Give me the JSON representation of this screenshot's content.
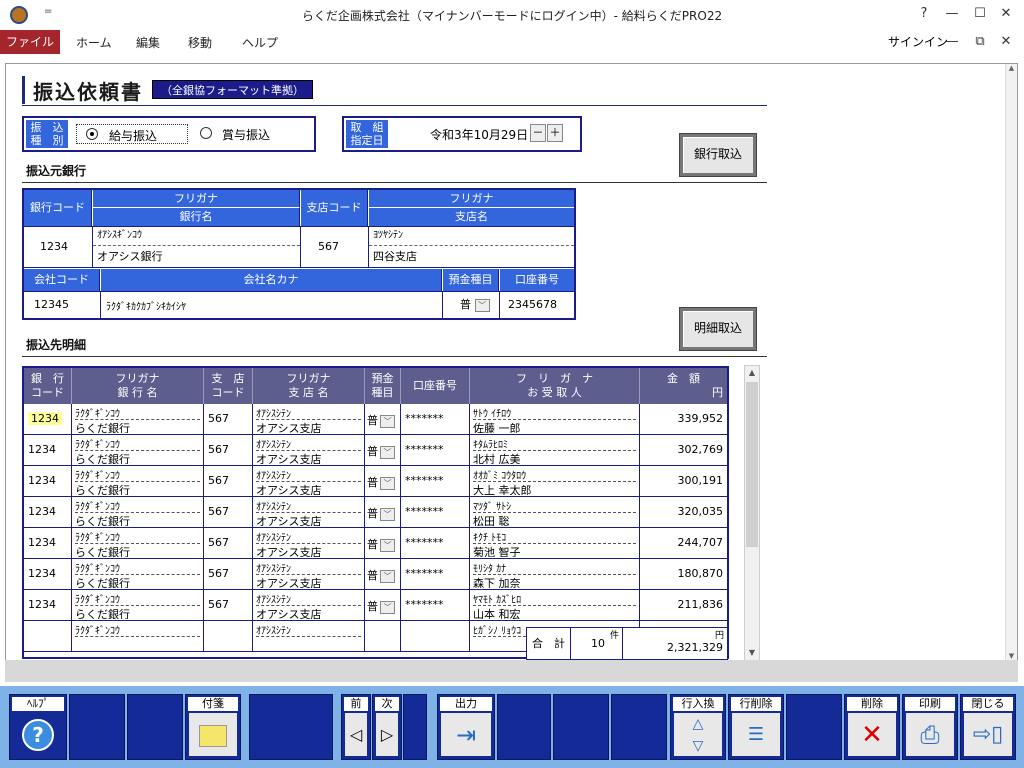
{
  "window": {
    "title": "らくだ企画株式会社（マイナンバーモードにログイン中）- 給料らくだPRO22",
    "help_glyph": "?",
    "min_glyph": "—",
    "max_glyph": "☐",
    "close_glyph": "✕",
    "restore_glyph": "⧉",
    "qa_glyph": "="
  },
  "menu": {
    "file": "ファイル",
    "home": "ホーム",
    "edit": "編集",
    "move": "移動",
    "help": "ヘルプ",
    "signin": "サインイン"
  },
  "page": {
    "title": "振込依頼書",
    "format_badge": "（全銀協フォーマット準拠）"
  },
  "transfer_type": {
    "label": "振込種別",
    "label_l1": "振　込",
    "label_l2": "種　別",
    "opt_salary": "給与振込",
    "opt_bonus": "賞与振込",
    "selected": "給与振込"
  },
  "date": {
    "label_l1": "取　組",
    "label_l2": "指定日",
    "value": "令和3年10月29日",
    "minus": "－",
    "plus": "＋"
  },
  "buttons": {
    "bank_import": "銀行取込",
    "detail_import": "明細取込"
  },
  "source_bank": {
    "section": "振込元銀行",
    "h_bank_code": "銀行コード",
    "h_furigana": "フリガナ",
    "h_bank_name": "銀行名",
    "h_branch_code": "支店コード",
    "h_branch_name": "支店名",
    "bank_code": "1234",
    "bank_kana": "ｵｱｼｽｷﾞﾝｺｳ",
    "bank_name": "オアシス銀行",
    "branch_code": "567",
    "branch_kana": "ﾖﾂﾔｼﾃﾝ",
    "branch_name": "四谷支店",
    "h_company_code": "会社コード",
    "h_company_kana": "会社名カナ",
    "h_deposit_type": "預金種目",
    "h_account_no": "口座番号",
    "company_code": "12345",
    "company_kana": "ﾗｸﾀﾞｷｶｸｶﾌﾞｼｷｶｲｼﾔ",
    "deposit_type": "普",
    "account_no": "2345678"
  },
  "detail": {
    "section": "振込先明細",
    "h_bank_code_1": "銀　行",
    "h_bank_code_2": "コード",
    "h_kana_1": "フリガナ",
    "h_bank_name": "銀 行 名",
    "h_branch_code_1": "支　店",
    "h_branch_code_2": "コード",
    "h_kana_2": "フリガナ",
    "h_branch_name": "支 店 名",
    "h_deposit_1": "預金",
    "h_deposit_2": "種目",
    "h_account": "口座番号",
    "h_kana_3": "フ　リ　ガ　ナ",
    "h_payee": "お 受 取 人",
    "h_amount": "金　額",
    "h_yen": "円",
    "rows": [
      {
        "bank_code": "1234",
        "bank_kana": "ﾗｸﾀﾞｷﾞﾝｺｳ",
        "bank_name": "らくだ銀行",
        "branch_code": "567",
        "branch_kana": "ｵｱｼｽｼﾃﾝ",
        "branch_name": "オアシス支店",
        "deposit": "普",
        "account": "*******",
        "payee_kana": "ｻﾄｳ ｲﾁﾛｳ",
        "payee": "佐藤 一郎",
        "amount": "339,952"
      },
      {
        "bank_code": "1234",
        "bank_kana": "ﾗｸﾀﾞｷﾞﾝｺｳ",
        "bank_name": "らくだ銀行",
        "branch_code": "567",
        "branch_kana": "ｵｱｼｽｼﾃﾝ",
        "branch_name": "オアシス支店",
        "deposit": "普",
        "account": "*******",
        "payee_kana": "ｷﾀﾑﾗﾋﾛﾐ",
        "payee": "北村 広美",
        "amount": "302,769"
      },
      {
        "bank_code": "1234",
        "bank_kana": "ﾗｸﾀﾞｷﾞﾝｺｳ",
        "bank_name": "らくだ銀行",
        "branch_code": "567",
        "branch_kana": "ｵｱｼｽｼﾃﾝ",
        "branch_name": "オアシス支店",
        "deposit": "普",
        "account": "*******",
        "payee_kana": "ｵｵｶﾞﾐ ｺｳﾀﾛｳ",
        "payee": "大上 幸太郎",
        "amount": "300,191"
      },
      {
        "bank_code": "1234",
        "bank_kana": "ﾗｸﾀﾞｷﾞﾝｺｳ",
        "bank_name": "らくだ銀行",
        "branch_code": "567",
        "branch_kana": "ｵｱｼｽｼﾃﾝ",
        "branch_name": "オアシス支店",
        "deposit": "普",
        "account": "*******",
        "payee_kana": "ﾏﾂﾀﾞ ｻﾄｼ",
        "payee": "松田 聡",
        "amount": "320,035"
      },
      {
        "bank_code": "1234",
        "bank_kana": "ﾗｸﾀﾞｷﾞﾝｺｳ",
        "bank_name": "らくだ銀行",
        "branch_code": "567",
        "branch_kana": "ｵｱｼｽｼﾃﾝ",
        "branch_name": "オアシス支店",
        "deposit": "普",
        "account": "*******",
        "payee_kana": "ｷｸﾁ ﾄﾓｺ",
        "payee": "菊池 智子",
        "amount": "244,707"
      },
      {
        "bank_code": "1234",
        "bank_kana": "ﾗｸﾀﾞｷﾞﾝｺｳ",
        "bank_name": "らくだ銀行",
        "branch_code": "567",
        "branch_kana": "ｵｱｼｽｼﾃﾝ",
        "branch_name": "オアシス支店",
        "deposit": "普",
        "account": "*******",
        "payee_kana": "ﾓﾘｼﾀ ｶﾅ",
        "payee": "森下 加奈",
        "amount": "180,870"
      },
      {
        "bank_code": "1234",
        "bank_kana": "ﾗｸﾀﾞｷﾞﾝｺｳ",
        "bank_name": "らくだ銀行",
        "branch_code": "567",
        "branch_kana": "ｵｱｼｽｼﾃﾝ",
        "branch_name": "オアシス支店",
        "deposit": "普",
        "account": "*******",
        "payee_kana": "ﾔﾏﾓﾄ ｶｽﾞﾋﾛ",
        "payee": "山本 和宏",
        "amount": "211,836"
      },
      {
        "bank_code": "",
        "bank_kana": "ﾗｸﾀﾞｷﾞﾝｺｳ",
        "bank_name": "",
        "branch_code": "",
        "branch_kana": "ｵｱｼｽｼﾃﾝ",
        "branch_name": "",
        "deposit": "",
        "account": "",
        "payee_kana": "ﾋｶﾞｼﾉ ﾘｮｳｺ",
        "payee": "",
        "amount": ""
      }
    ],
    "total_label": "合　計",
    "count": "10",
    "count_unit": "件",
    "total_amount": "2,321,329",
    "total_yen": "円"
  },
  "toolbar": {
    "help": "ﾍﾙﾌﾟ",
    "sticky": "付箋",
    "prev": "前",
    "next": "次",
    "output": "出力",
    "row_swap": "行入換",
    "row_delete": "行削除",
    "delete": "削除",
    "print": "印刷",
    "close": "閉じる"
  }
}
